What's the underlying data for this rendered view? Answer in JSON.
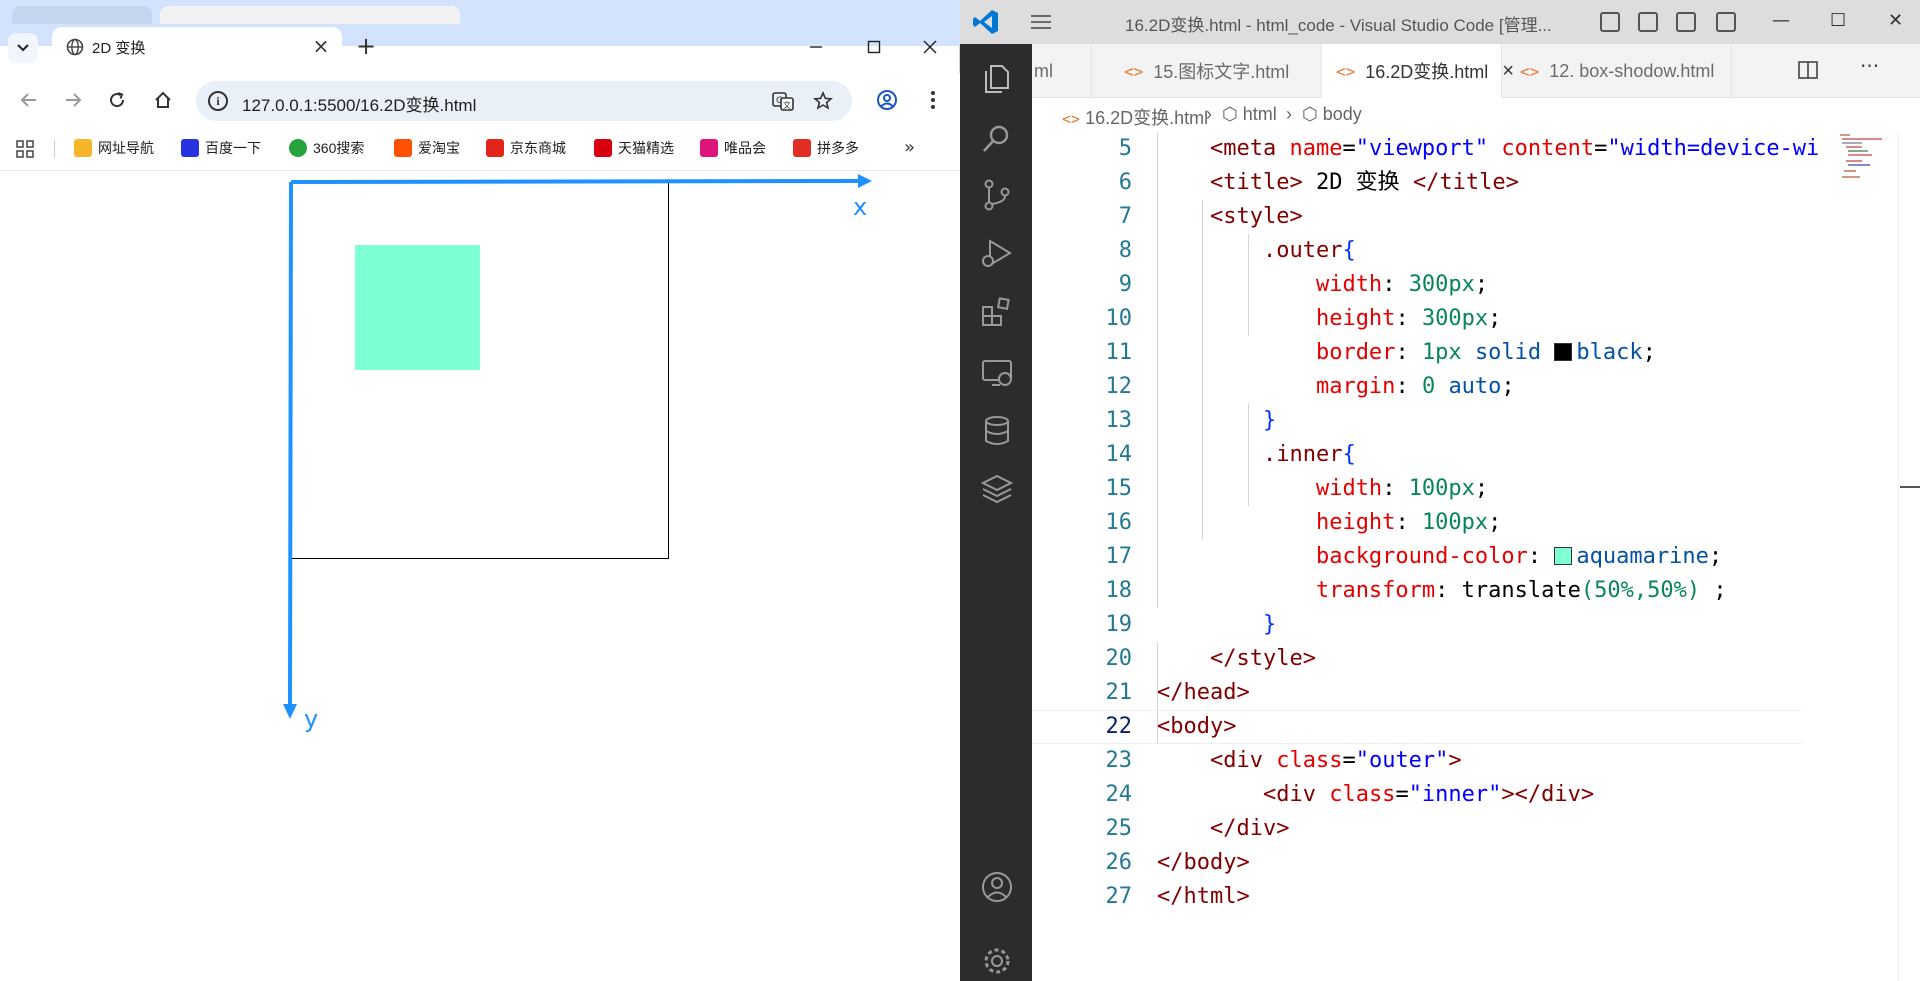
{
  "browser": {
    "tab_title": "2D 变换",
    "new_tab": "+",
    "url": "127.0.0.1:5500/16.2D变换.html",
    "bookmarks": [
      {
        "label": "网址导航",
        "color": "#f7b52b",
        "icon": "hao"
      },
      {
        "label": "百度一下",
        "color": "#2932e1",
        "icon": "paw"
      },
      {
        "label": "360搜索",
        "color": "#26a33e",
        "icon": "360"
      },
      {
        "label": "爱淘宝",
        "color": "#ff5000",
        "icon": "淘"
      },
      {
        "label": "京东商城",
        "color": "#e1251b",
        "icon": "JD"
      },
      {
        "label": "天猫精选",
        "color": "#d6000f",
        "icon": "T"
      },
      {
        "label": "唯品会",
        "color": "#e0157b",
        "icon": "特"
      },
      {
        "label": "拼多多",
        "color": "#e02e24",
        "icon": "pdd"
      }
    ],
    "bookmarks_more": "»",
    "page": {
      "x_label": "x",
      "y_label": "y",
      "axis_color": "#1e90ff",
      "inner_color": "#7fffd4"
    }
  },
  "vscode": {
    "title": "16.2D变换.html - html_code - Visual Studio Code [管理...",
    "tabs": [
      {
        "label": "ml",
        "active": false
      },
      {
        "label": "15.图标文字.html",
        "active": false
      },
      {
        "label": "16.2D变换.html",
        "active": true
      },
      {
        "label": "12. box-shodow.html",
        "active": false
      }
    ],
    "tab_close": "×",
    "breadcrumb": [
      "16.2D变换.html",
      "html",
      "body"
    ],
    "line_numbers": [
      "5",
      "6",
      "7",
      "8",
      "9",
      "10",
      "11",
      "12",
      "13",
      "14",
      "15",
      "16",
      "17",
      "18",
      "19",
      "20",
      "21",
      "22",
      "23",
      "24",
      "25",
      "26",
      "27"
    ],
    "current_line": "22",
    "code": {
      "l5": {
        "tag_open": "<meta",
        "attr1": "name",
        "val1": "\"viewport\"",
        "attr2": "content",
        "val2": "\"width=device-wi"
      },
      "l6": {
        "tag_open": "<title>",
        "text": " 2D 变换 ",
        "tag_close": "</title>"
      },
      "l7": {
        "tag": "<style>"
      },
      "l8": {
        "selector": ".outer",
        "brace": "{"
      },
      "l9": {
        "prop": "width",
        "val": "300px"
      },
      "l10": {
        "prop": "height",
        "val": "300px"
      },
      "l11": {
        "prop": "border",
        "num": "1px",
        "kw": "solid",
        "color_name": "black",
        "swatch": "#000000"
      },
      "l12": {
        "prop": "margin",
        "num": "0",
        "kw": "auto"
      },
      "l13": {
        "brace": "}"
      },
      "l14": {
        "selector": ".inner",
        "brace": "{"
      },
      "l15": {
        "prop": "width",
        "val": "100px"
      },
      "l16": {
        "prop": "height",
        "val": "100px"
      },
      "l17": {
        "prop": "background-color",
        "color_name": "aquamarine",
        "swatch": "#7fffd4"
      },
      "l18": {
        "prop": "transform",
        "fn": "translate",
        "args": "(50%,50%)",
        "tail": " ;"
      },
      "l19": {
        "brace": "}"
      },
      "l20": {
        "tag": "</style>"
      },
      "l21": {
        "tag": "</head>"
      },
      "l22": {
        "tag": "<body>"
      },
      "l23": {
        "tag_open": "<div",
        "attr": "class",
        "val": "\"outer\"",
        "tag_end": ">"
      },
      "l24": {
        "tag_open": "<div",
        "attr": "class",
        "val": "\"inner\"",
        "tag_end": "></div>"
      },
      "l25": {
        "tag": "</div>"
      },
      "l26": {
        "tag": "</body>"
      },
      "l27": {
        "tag": "</html>"
      }
    }
  }
}
